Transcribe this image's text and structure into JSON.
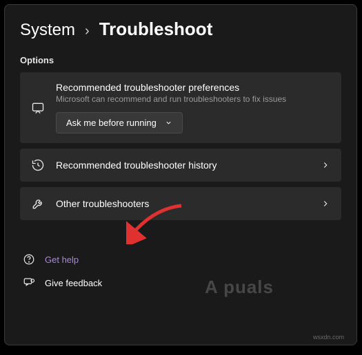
{
  "breadcrumb": {
    "parent": "System",
    "separator": "›",
    "current": "Troubleshoot"
  },
  "section_label": "Options",
  "cards": {
    "preferences": {
      "title": "Recommended troubleshooter preferences",
      "subtitle": "Microsoft can recommend and run troubleshooters to fix issues",
      "dropdown_value": "Ask me before running"
    },
    "history": {
      "title": "Recommended troubleshooter history"
    },
    "other": {
      "title": "Other troubleshooters"
    }
  },
  "footer": {
    "help": "Get help",
    "feedback": "Give feedback"
  },
  "watermark": "A   puals",
  "site": "wsxdn.com"
}
